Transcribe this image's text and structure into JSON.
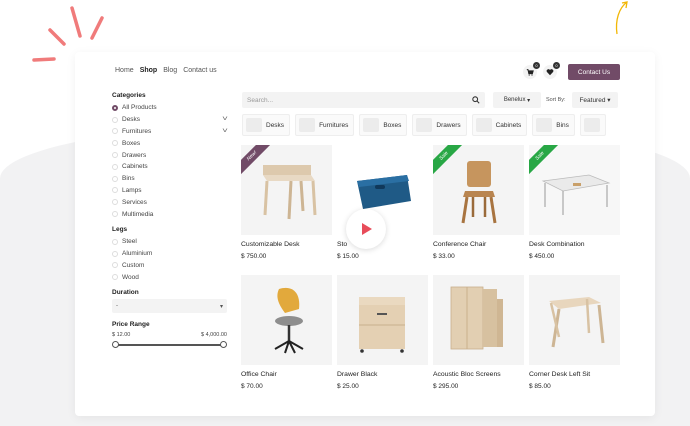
{
  "nav": {
    "links": [
      "Home",
      "Shop",
      "Blog",
      "Contact us"
    ]
  },
  "header": {
    "cart_count": "0",
    "wishlist_count": "0",
    "contact_label": "Contact Us"
  },
  "sidebar": {
    "categories_title": "Categories",
    "categories": [
      "All Products",
      "Desks",
      "Furnitures",
      "Boxes",
      "Drawers",
      "Cabinets",
      "Bins",
      "Lamps",
      "Services",
      "Multimedia"
    ],
    "legs_title": "Legs",
    "legs": [
      "Steel",
      "Aluminium",
      "Custom",
      "Wood"
    ],
    "duration_title": "Duration",
    "duration_value": "-",
    "price_title": "Price Range",
    "price_min": "$ 12.00",
    "price_max": "$ 4,000.00"
  },
  "search": {
    "placeholder": "Search..."
  },
  "pricelist": "Benelux",
  "sort": {
    "label": "Sort By:",
    "value": "Featured"
  },
  "category_chips": [
    "Desks",
    "Furnitures",
    "Boxes",
    "Drawers",
    "Cabinets",
    "Bins"
  ],
  "products": [
    {
      "name": "Customizable Desk",
      "price": "$ 750.00",
      "ribbon": "New!"
    },
    {
      "name": "Sto",
      "price": "$ 15.00",
      "ribbon": ""
    },
    {
      "name": "Conference Chair",
      "price": "$ 33.00",
      "ribbon": "Sale"
    },
    {
      "name": "Desk Combination",
      "price": "$ 450.00",
      "ribbon": "Sale"
    },
    {
      "name": "Office Chair",
      "price": "$ 70.00",
      "ribbon": ""
    },
    {
      "name": "Drawer Black",
      "price": "$ 25.00",
      "ribbon": ""
    },
    {
      "name": "Acoustic Bloc Screens",
      "price": "$ 295.00",
      "ribbon": ""
    },
    {
      "name": "Corner Desk Left Sit",
      "price": "$ 85.00",
      "ribbon": ""
    }
  ],
  "colors": {
    "brand": "#714b67",
    "ribbon_new": "#714b67",
    "ribbon_sale": "#28a745",
    "accent_deco": "#f07b7b",
    "arrow_deco": "#f2b705"
  }
}
